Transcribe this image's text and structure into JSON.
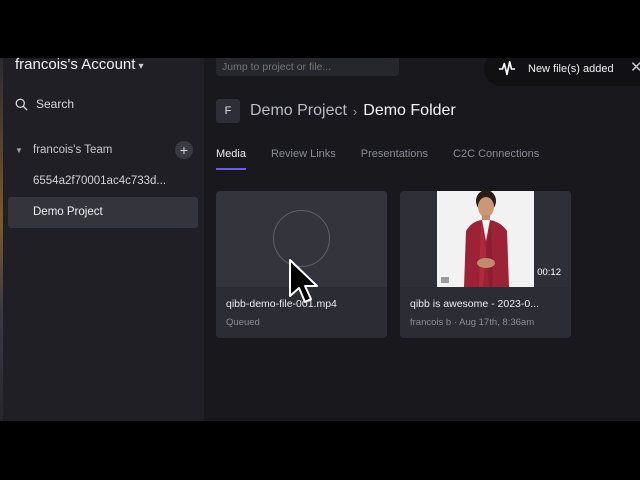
{
  "sidebar": {
    "account_title": "francois's Account",
    "search_label": "Search",
    "team_label": "francois's Team",
    "project_id": "6554a2f70001ac4c733d...",
    "selected_project": "Demo Project"
  },
  "header": {
    "jump_placeholder": "Jump to project or file...",
    "breadcrumb": {
      "badge": "F",
      "project": "Demo Project",
      "folder": "Demo Folder"
    }
  },
  "notification": {
    "text": "New file(s) added"
  },
  "tabs": [
    {
      "label": "Media",
      "active": true
    },
    {
      "label": "Review Links",
      "active": false
    },
    {
      "label": "Presentations",
      "active": false
    },
    {
      "label": "C2C Connections",
      "active": false
    }
  ],
  "files": [
    {
      "name": "qibb-demo-file-001.mp4",
      "status": "Queued"
    },
    {
      "name": "qibb is awesome - 2023-0...",
      "meta": "francois b · Aug 17th, 8:36am",
      "duration": "00:12"
    }
  ],
  "colors": {
    "accent": "#6a5df0",
    "background": "#18181d",
    "sidebar": "#1f1f25"
  },
  "icons": {
    "search": "search-icon",
    "waveform": "waveform-icon",
    "close": "close-icon",
    "plus": "plus-icon",
    "caret": "caret-down-icon",
    "cursor": "mouse-pointer-icon"
  }
}
